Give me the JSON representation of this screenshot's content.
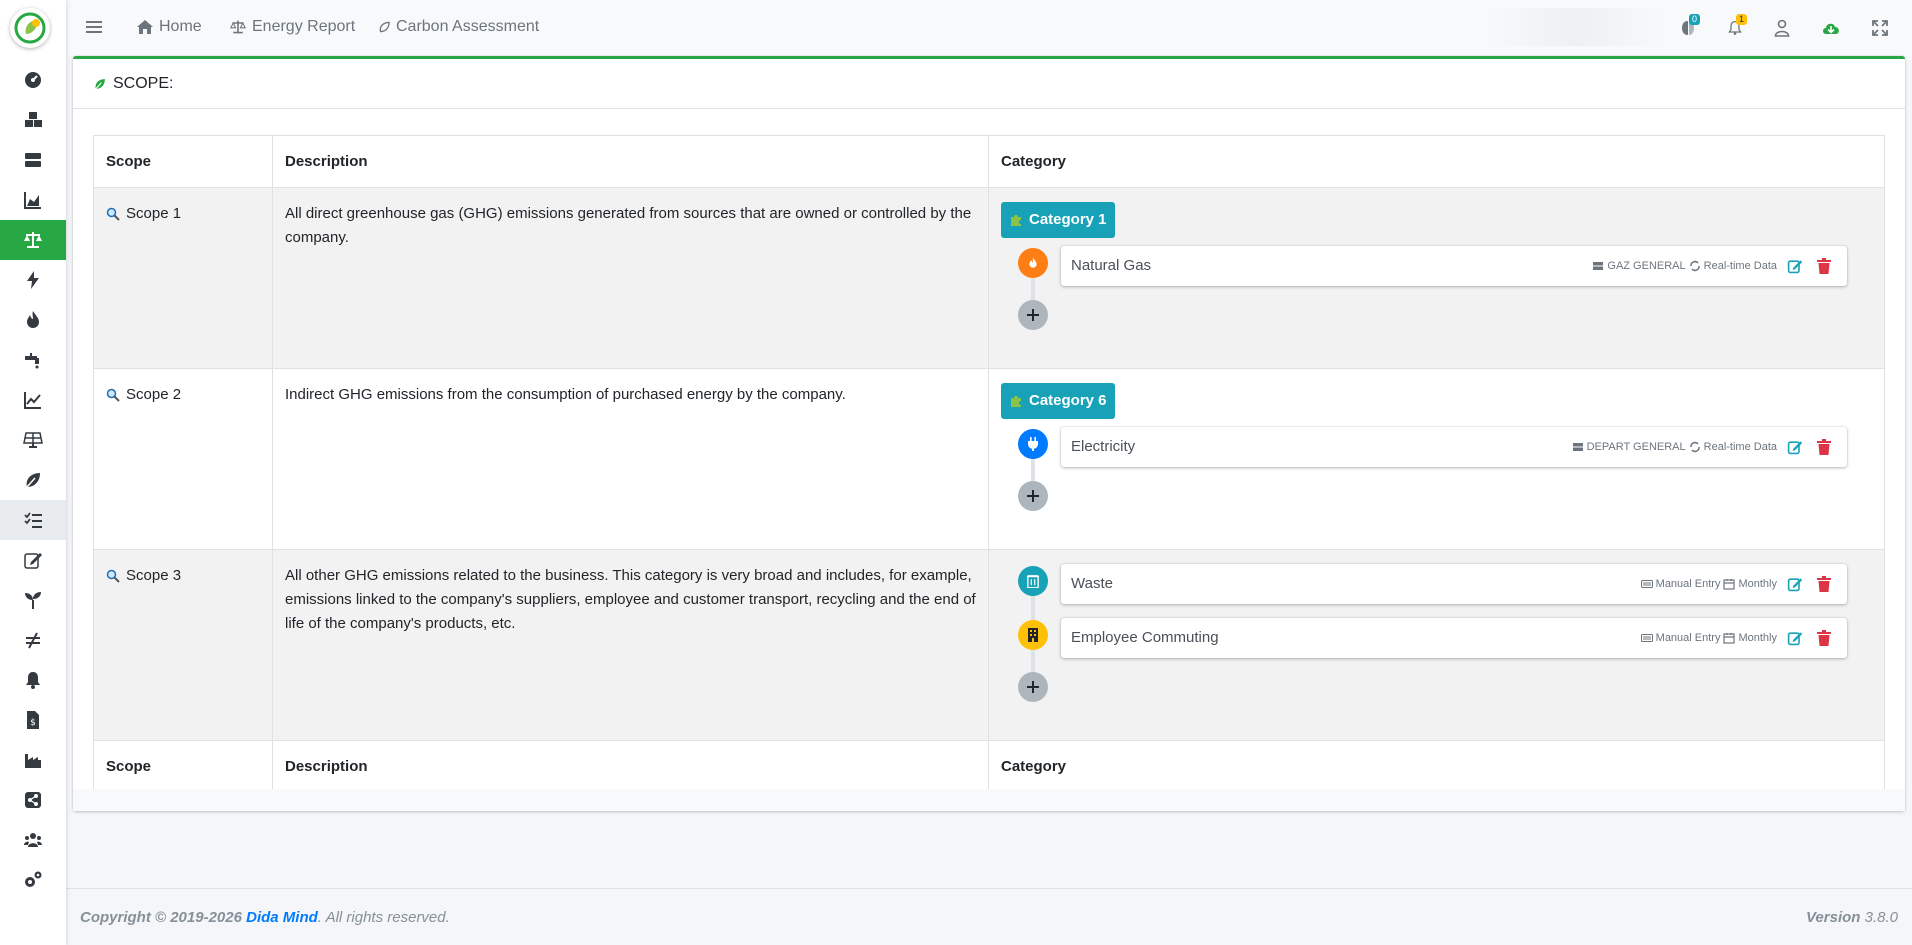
{
  "nav": {
    "home": "Home",
    "energy_report": "Energy Report",
    "carbon_assessment": "Carbon Assessment",
    "badge_messages": "0",
    "badge_notifications": "1"
  },
  "card": {
    "title": "SCOPE:"
  },
  "table": {
    "headers": {
      "scope": "Scope",
      "description": "Description",
      "category": "Category"
    },
    "rows": [
      {
        "scope": "Scope 1",
        "description": "All direct greenhouse gas (GHG) emissions generated from sources that are owned or controlled by the company.",
        "category": "Category 1",
        "items": [
          {
            "name": "Natural Gas",
            "source": "GAZ GENERAL",
            "mode": "Real-time Data",
            "icon": "fire-icon",
            "color": "#fd7e14"
          }
        ]
      },
      {
        "scope": "Scope 2",
        "description": "Indirect GHG emissions from the consumption of purchased energy by the company.",
        "category": "Category 6",
        "items": [
          {
            "name": "Electricity",
            "source": "DEPART GENERAL",
            "mode": "Real-time Data",
            "icon": "plug-icon",
            "color": "#007bff"
          }
        ]
      },
      {
        "scope": "Scope 3",
        "description": "All other GHG emissions related to the business. This category is very broad and includes, for example, emissions linked to the company's suppliers, employee and customer transport, recycling and the end of life of the company's products, etc.",
        "items": [
          {
            "name": "Waste",
            "source": "Manual Entry",
            "mode": "Monthly",
            "icon": "trash-icon",
            "color": "#17a2b8"
          },
          {
            "name": "Employee Commuting",
            "source": "Manual Entry",
            "mode": "Monthly",
            "icon": "building-icon",
            "color": "#ffc107"
          }
        ]
      }
    ]
  },
  "footer": {
    "copyright": "Copyright © 2019-2026",
    "brand": "Dida Mind",
    "rights": ". All rights reserved.",
    "version_label": "Version",
    "version": "3.8.0"
  },
  "colors": {
    "accent": "#28a745",
    "info": "#17a2b8",
    "danger": "#dc3545"
  }
}
